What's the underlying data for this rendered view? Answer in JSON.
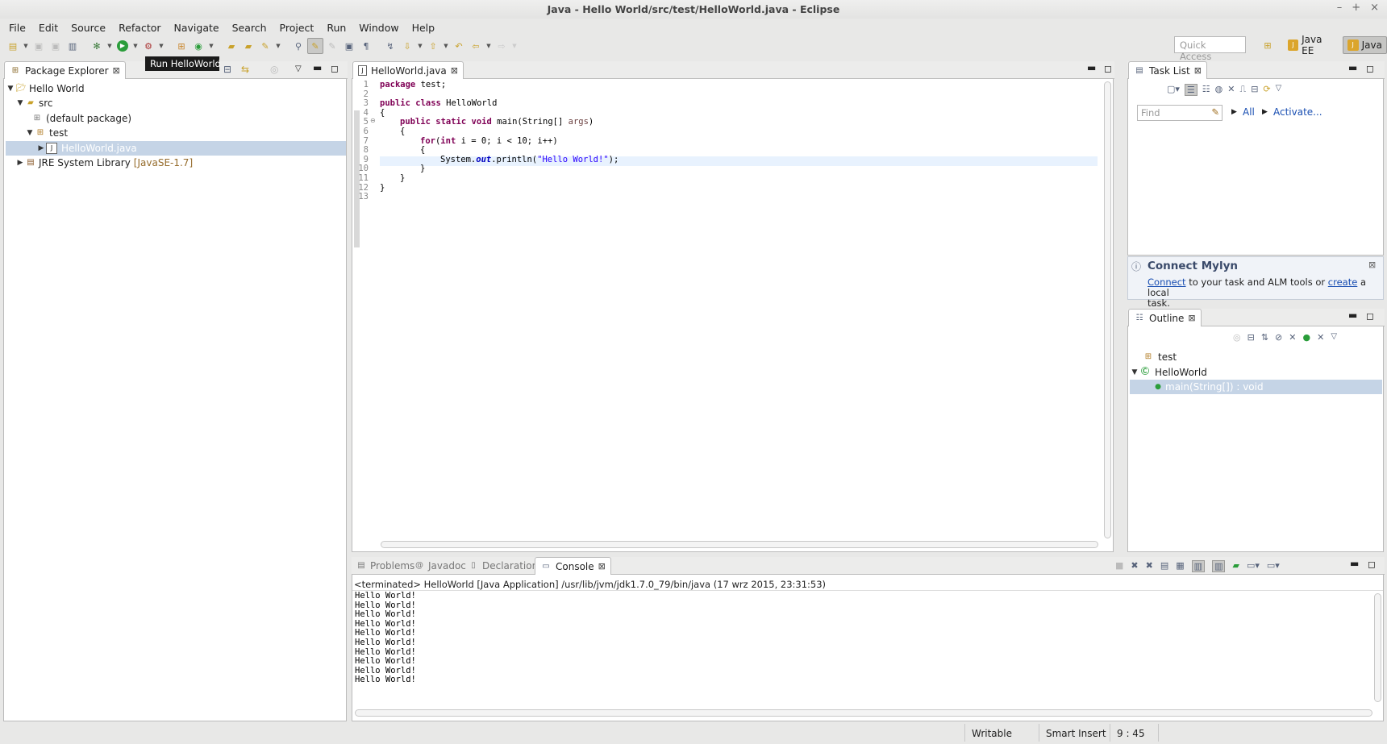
{
  "window": {
    "title": "Java - Hello World/src/test/HelloWorld.java - Eclipse"
  },
  "menu": [
    "File",
    "Edit",
    "Source",
    "Refactor",
    "Navigate",
    "Search",
    "Project",
    "Run",
    "Window",
    "Help"
  ],
  "toolbar": {
    "quick_access_placeholder": "Quick Access",
    "tooltip": "Run HelloWorld"
  },
  "perspectives": {
    "java_ee": "Java EE",
    "java": "Java"
  },
  "package_explorer": {
    "tab": "Package Explorer",
    "tree": [
      {
        "label": "Hello World"
      },
      {
        "label": "src"
      },
      {
        "label": "(default package)"
      },
      {
        "label": "test"
      },
      {
        "label": "HelloWorld.java"
      },
      {
        "label": "JRE System Library",
        "suffix": "[JavaSE-1.7]"
      }
    ]
  },
  "editor": {
    "tab": "HelloWorld.java",
    "line_numbers": [
      "1",
      "2",
      "3",
      "4",
      "5",
      "6",
      "7",
      "8",
      "9",
      "10",
      "11",
      "12",
      "13"
    ],
    "code": {
      "l1_kw": "package",
      "l1_rest": " test;",
      "l3_kw": "public class",
      "l3_rest": " HelloWorld",
      "l4": "{",
      "l5_kw": "public static void",
      "l5_rest": " main(String[] ",
      "l5_par": "args",
      "l5_end": ")",
      "l6": "{",
      "l7_kw": "for",
      "l7_a": "(",
      "l7_kw2": "int",
      "l7_b": " i = 0; i < 10; i++)",
      "l8": "{",
      "l9_a": "System.",
      "l9_fld": "out",
      "l9_b": ".println(",
      "l9_str": "\"Hello World!\"",
      "l9_c": ");",
      "l10": "}",
      "l11": "}",
      "l12": "}"
    }
  },
  "task_list": {
    "tab": "Task List",
    "find_placeholder": "Find",
    "all": "All",
    "activate": "Activate..."
  },
  "mylyn": {
    "title": "Connect Mylyn",
    "connect": "Connect",
    "text1": " to your task and ALM tools or ",
    "create": "create",
    "text2": " a local",
    "text3": "task."
  },
  "outline": {
    "tab": "Outline",
    "items": [
      {
        "label": "test"
      },
      {
        "label": "HelloWorld"
      },
      {
        "label": "main(String[]) : void"
      }
    ]
  },
  "bottom": {
    "tabs": {
      "problems": "Problems",
      "javadoc": "Javadoc",
      "declaration": "Declaration",
      "console": "Console"
    },
    "status_line": "<terminated> HelloWorld [Java Application] /usr/lib/jvm/jdk1.7.0_79/bin/java (17 wrz 2015, 23:31:53)",
    "output": [
      "Hello World!",
      "Hello World!",
      "Hello World!",
      "Hello World!",
      "Hello World!",
      "Hello World!",
      "Hello World!",
      "Hello World!",
      "Hello World!",
      "Hello World!"
    ]
  },
  "status": {
    "writable": "Writable",
    "insert_mode": "Smart Insert",
    "position": "9 : 45"
  },
  "colors": {
    "selection": "#c5d4e6",
    "keyword": "#7f0055",
    "string": "#2a00ff",
    "link": "#1a4fb2"
  }
}
